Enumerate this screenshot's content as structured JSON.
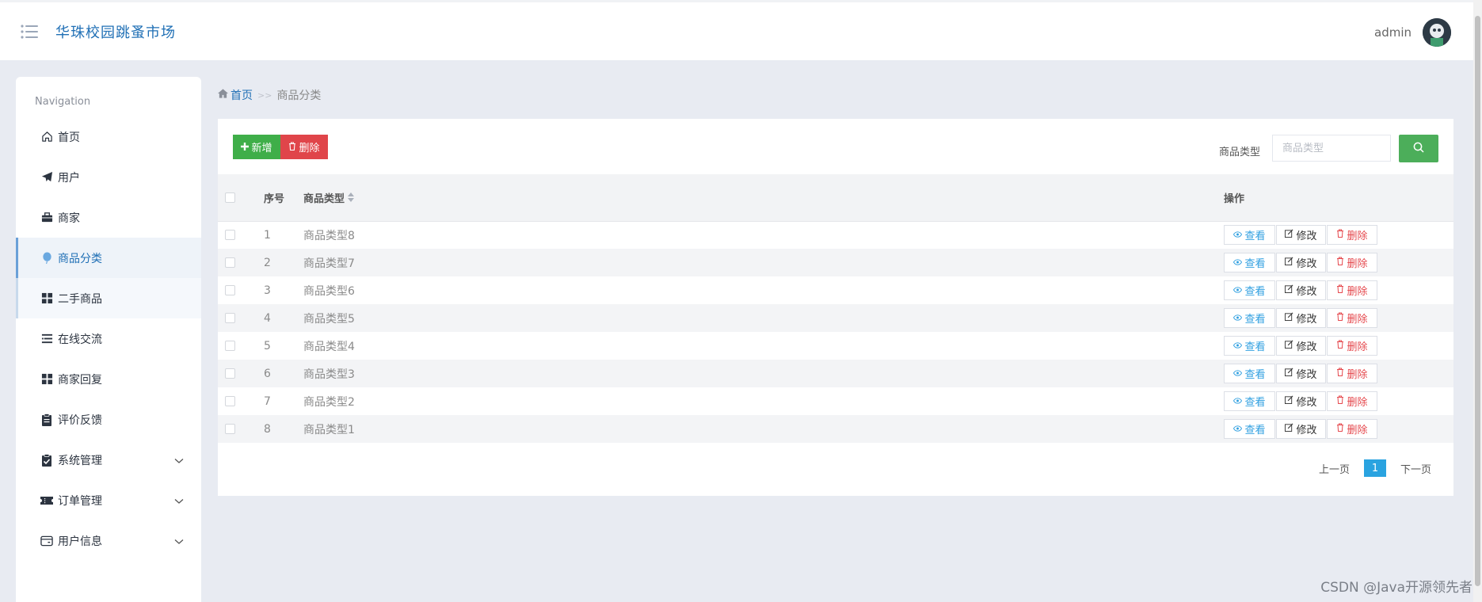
{
  "header": {
    "title": "华珠校园跳蚤市场",
    "username": "admin"
  },
  "sidebar": {
    "caption": "Navigation",
    "items": [
      {
        "label": "首页",
        "icon": "home-icon"
      },
      {
        "label": "用户",
        "icon": "paper-plane-icon"
      },
      {
        "label": "商家",
        "icon": "briefcase-icon"
      },
      {
        "label": "商品分类",
        "icon": "balloon-icon",
        "active": true
      },
      {
        "label": "二手商品",
        "icon": "grid-icon"
      },
      {
        "label": "在线交流",
        "icon": "list-icon"
      },
      {
        "label": "商家回复",
        "icon": "grid-icon"
      },
      {
        "label": "评价反馈",
        "icon": "clipboard-icon"
      },
      {
        "label": "系统管理",
        "icon": "clipboard-check-icon",
        "expandable": true
      },
      {
        "label": "订单管理",
        "icon": "ticket-icon",
        "expandable": true
      },
      {
        "label": "用户信息",
        "icon": "wallet-icon",
        "expandable": true
      }
    ]
  },
  "breadcrumb": {
    "home": "首页",
    "separator": ">>",
    "current": "商品分类"
  },
  "toolbar": {
    "add_label": "新增",
    "delete_label": "删除",
    "search_label": "商品类型",
    "search_placeholder": "商品类型",
    "search_value": ""
  },
  "table": {
    "headers": {
      "index": "序号",
      "type": "商品类型",
      "ops": "操作"
    },
    "rows": [
      {
        "index": "1",
        "type": "商品类型8"
      },
      {
        "index": "2",
        "type": "商品类型7"
      },
      {
        "index": "3",
        "type": "商品类型6"
      },
      {
        "index": "4",
        "type": "商品类型5"
      },
      {
        "index": "5",
        "type": "商品类型4"
      },
      {
        "index": "6",
        "type": "商品类型3"
      },
      {
        "index": "7",
        "type": "商品类型2"
      },
      {
        "index": "8",
        "type": "商品类型1"
      }
    ],
    "actions": {
      "view": "查看",
      "edit": "修改",
      "delete": "删除"
    }
  },
  "pagination": {
    "prev": "上一页",
    "current": "1",
    "next": "下一页"
  },
  "watermark": "CSDN @Java开源领先者",
  "colors": {
    "accent": "#1f6fb5",
    "add": "#3fae49",
    "delete": "#e0454a",
    "search": "#4cae5a",
    "view": "#2f9fe0",
    "page_active": "#2aa3e0"
  }
}
